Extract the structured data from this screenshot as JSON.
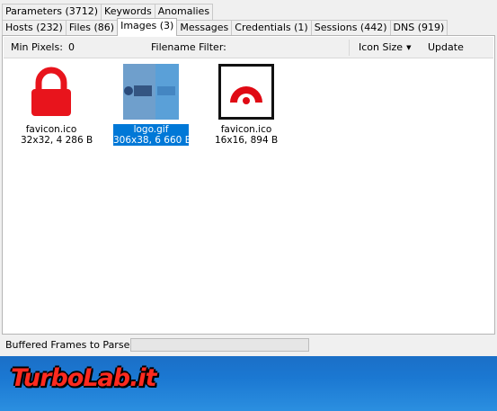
{
  "tabs_row1": [
    {
      "label": "Parameters (3712)"
    },
    {
      "label": "Keywords"
    },
    {
      "label": "Anomalies"
    }
  ],
  "tabs_row2": [
    {
      "label": "Hosts (232)"
    },
    {
      "label": "Files (86)"
    },
    {
      "label": "Images (3)",
      "active": true
    },
    {
      "label": "Messages"
    },
    {
      "label": "Credentials (1)"
    },
    {
      "label": "Sessions (442)"
    },
    {
      "label": "DNS (919)"
    }
  ],
  "toolbar": {
    "min_pixels_label": "Min Pixels:",
    "min_pixels_value": "0",
    "filename_filter_label": "Filename Filter:",
    "icon_size_label": "Icon Size",
    "update_label": "Update"
  },
  "images": [
    {
      "filename": "favicon.ico",
      "info": "32x32, 4 286 B",
      "selected": false,
      "icon": "lock-icon"
    },
    {
      "filename": "logo.gif",
      "info": "306x38, 6 660 B",
      "selected": true,
      "icon": "logo-thumbnail"
    },
    {
      "filename": "favicon.ico",
      "info": "16x16, 894 B",
      "selected": false,
      "icon": "semicircle-favicon"
    }
  ],
  "status": {
    "buffered_frames_label": "Buffered Frames to Parse:",
    "progress_fraction": 0
  },
  "watermark": {
    "text": "TurboLab.it"
  },
  "colors": {
    "selection": "#0078d7",
    "icon_red": "#e8141c",
    "desktop_blue": "#1b78d2"
  }
}
